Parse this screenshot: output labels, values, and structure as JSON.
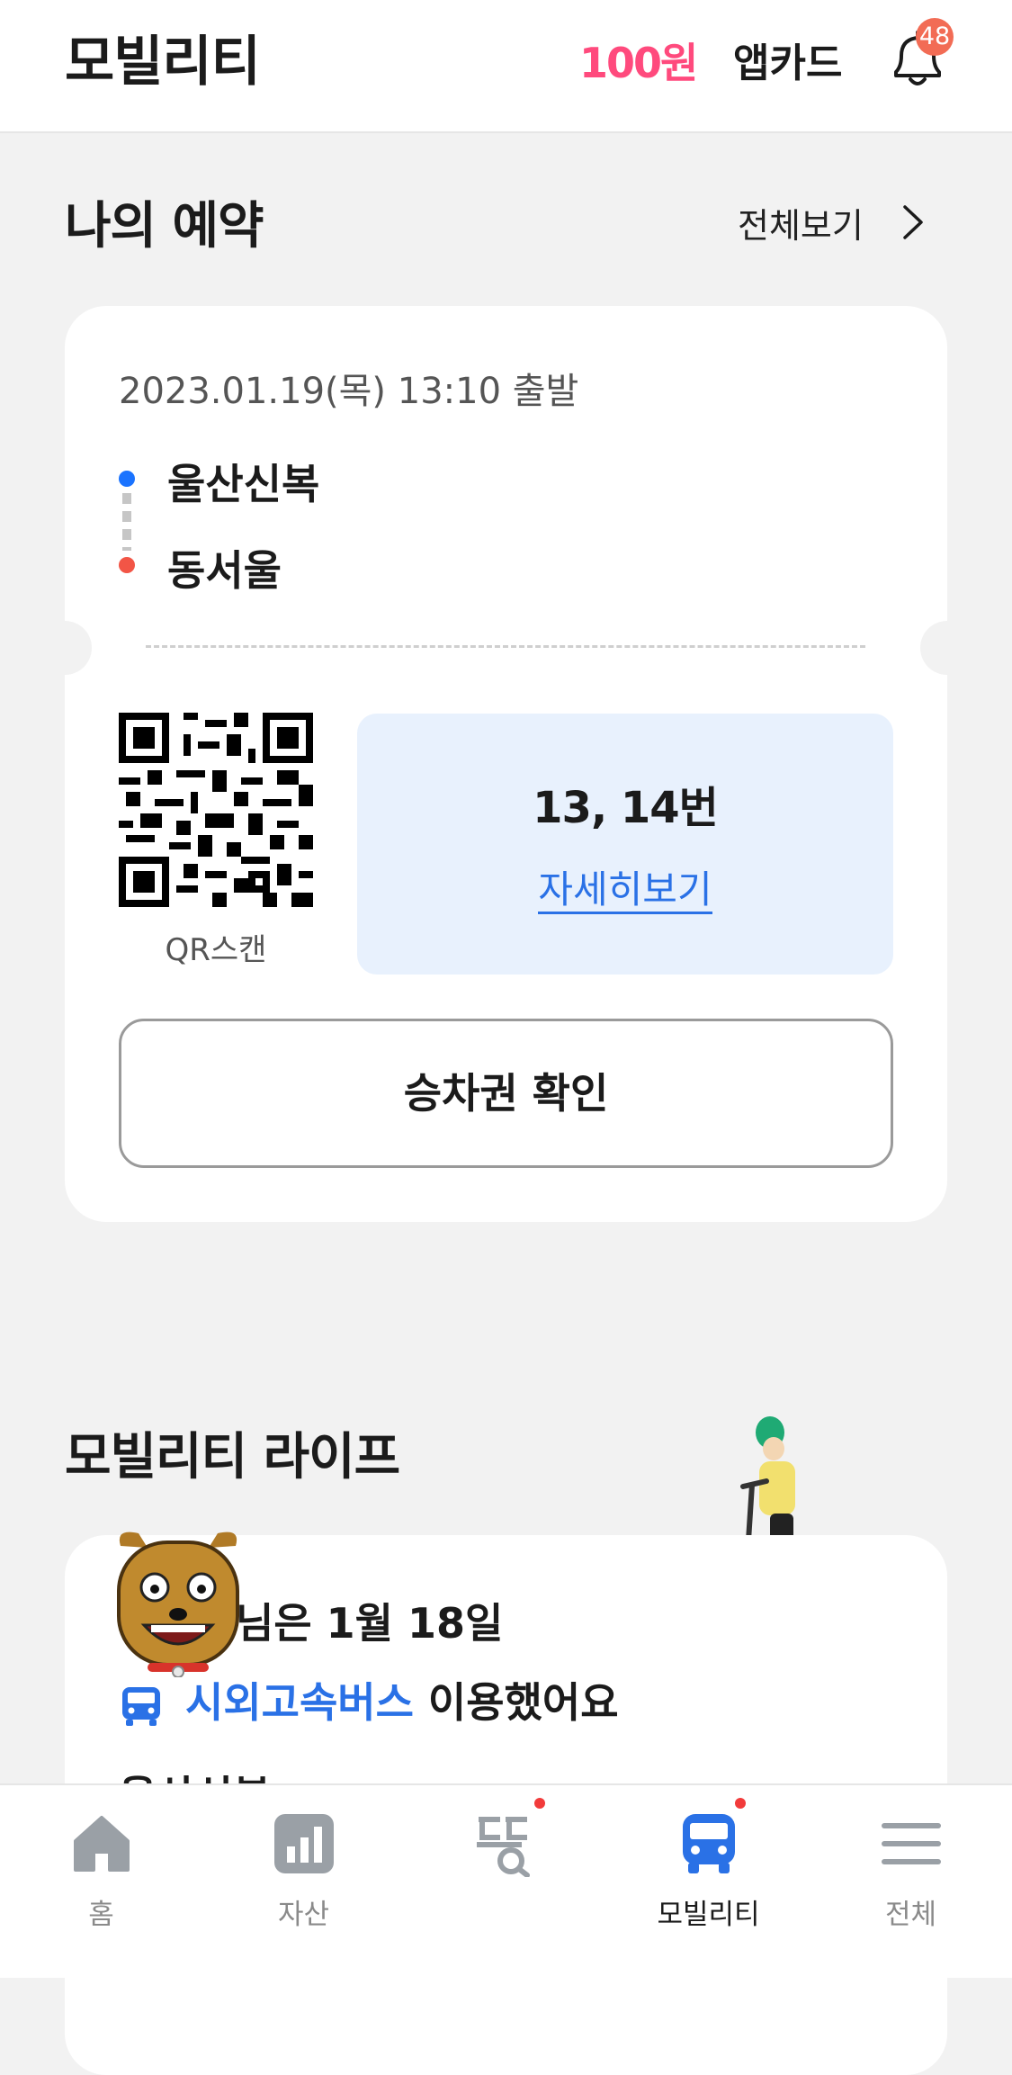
{
  "header": {
    "title": "모빌리티",
    "points": "100원",
    "appcard": "앱카드",
    "notification_count": "48"
  },
  "reservation": {
    "section_title": "나의 예약",
    "view_all": "전체보기",
    "datetime": "2023.01.19(목) 13:10 출발",
    "origin": "울산신복",
    "destination": "동서울",
    "qr_label": "QR스캔",
    "seats": "13, 14번",
    "detail_link": "자세히보기",
    "ticket_button": "승차권 확인"
  },
  "life": {
    "section_title": "모빌리티 라이프",
    "line1": "님은 1월 18일",
    "line2_highlight": "시외고속버스",
    "line2_rest": " 이용했어요",
    "line3": "울산신복"
  },
  "nav": [
    {
      "label": "홈",
      "icon": "home-icon"
    },
    {
      "label": "자산",
      "icon": "chart-icon"
    },
    {
      "label": "",
      "icon": "ddaeng-search-icon"
    },
    {
      "label": "모빌리티",
      "icon": "bus-icon"
    },
    {
      "label": "전체",
      "icon": "menu-icon"
    }
  ],
  "colors": {
    "accent_blue": "#2a71e6",
    "points_pink": "#ff4a7d",
    "badge_red": "#f26c55"
  }
}
